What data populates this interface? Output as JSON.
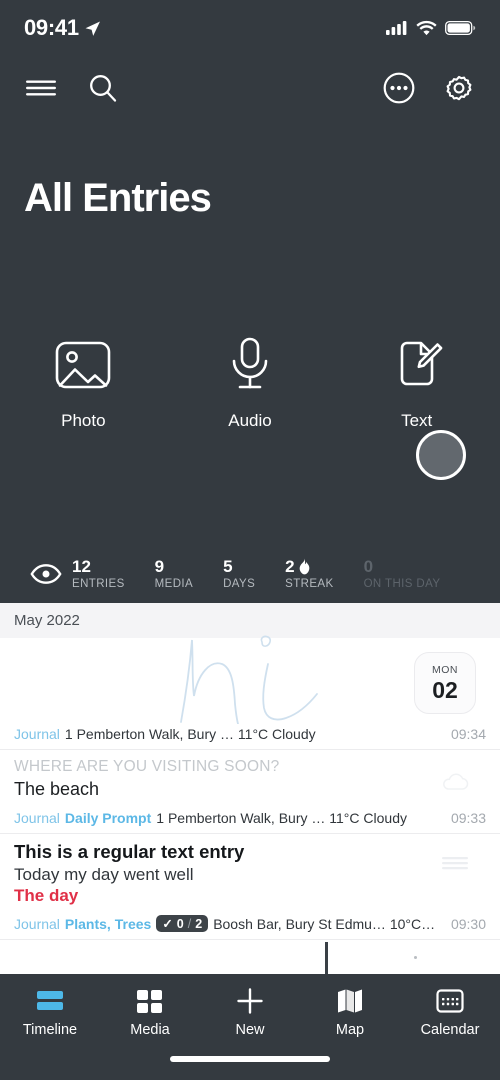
{
  "status_bar": {
    "time": "09:41",
    "location_icon": "location-arrow-icon",
    "signal_icon": "cellular-signal-icon",
    "wifi_icon": "wifi-icon",
    "battery_icon": "battery-full-icon"
  },
  "nav_bar": {
    "menu_icon": "hamburger-menu-icon",
    "search_icon": "search-icon",
    "more_icon": "more-options-icon",
    "settings_icon": "gear-icon"
  },
  "header": {
    "title": "All Entries"
  },
  "quick_actions": [
    {
      "label": "Photo",
      "icon": "photo-icon"
    },
    {
      "label": "Audio",
      "icon": "microphone-icon"
    },
    {
      "label": "Text",
      "icon": "text-document-pencil-icon"
    }
  ],
  "stats": {
    "visibility_icon": "eye-icon",
    "items": [
      {
        "value": "12",
        "label": "ENTRIES",
        "dim": false,
        "icon": ""
      },
      {
        "value": "9",
        "label": "MEDIA",
        "dim": false,
        "icon": ""
      },
      {
        "value": "5",
        "label": "DAYS",
        "dim": false,
        "icon": ""
      },
      {
        "value": "2",
        "label": "STREAK",
        "dim": false,
        "icon": "flame-icon"
      },
      {
        "value": "0",
        "label": "ON THIS DAY",
        "dim": true,
        "icon": ""
      }
    ]
  },
  "timeline": {
    "month_header": "May 2022",
    "date_badge": {
      "dow": "MON",
      "day": "02"
    },
    "entries": [
      {
        "kind": "sketch",
        "tag": "Journal",
        "meta": "1 Pemberton Walk, Bury … 11°C Cloudy",
        "time": "09:34",
        "sketch_alt": "handwritten-hi-sketch"
      },
      {
        "kind": "prompt",
        "prompt": "WHERE ARE YOU VISITING SOON?",
        "answer": "The beach",
        "tag": "Journal",
        "tag2": "Daily Prompt",
        "meta": "1 Pemberton Walk, Bury … 11°C Cloudy",
        "time": "09:33",
        "side_icon": "cloud-icon"
      },
      {
        "kind": "text",
        "title": "This is a regular text entry",
        "line1": "Today my day went well",
        "line2": "The day",
        "tag": "Journal",
        "tag2": "Plants, Trees",
        "checklist": {
          "check": "✓",
          "done": "0",
          "sep": "/",
          "total": "2"
        },
        "meta": "Boosh Bar, Bury St Edmu… 10°C…",
        "time": "09:30",
        "side_icon": "text-lines-icon"
      }
    ]
  },
  "tab_bar": {
    "tabs": [
      {
        "label": "Timeline",
        "icon": "timeline-icon",
        "active": true
      },
      {
        "label": "Media",
        "icon": "grid-icon",
        "active": false
      },
      {
        "label": "New",
        "icon": "plus-icon",
        "active": false
      },
      {
        "label": "Map",
        "icon": "map-icon",
        "active": false
      },
      {
        "label": "Calendar",
        "icon": "calendar-icon",
        "active": false
      }
    ]
  },
  "colors": {
    "background": "#343a40",
    "accent": "#4db8e8",
    "sheet": "#ffffff",
    "alert": "#e03047"
  }
}
